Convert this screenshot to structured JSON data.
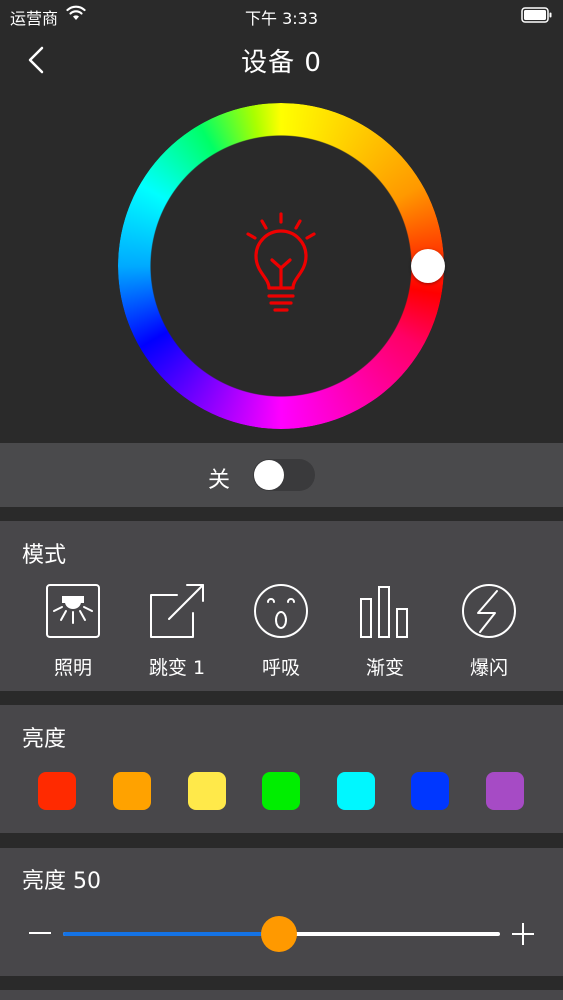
{
  "status_bar": {
    "carrier": "运营商",
    "time": "下午 3:33",
    "icons": [
      "wifi-icon",
      "battery-icon"
    ]
  },
  "nav": {
    "title": "设备 0",
    "back_icon": "chevron-left-icon"
  },
  "color_wheel": {
    "center_icon": "lightbulb-icon",
    "center_icon_color": "#ff0000",
    "selected_color": "#ff0000"
  },
  "power": {
    "label": "关",
    "state": "off"
  },
  "mode": {
    "title": "模式",
    "items": [
      {
        "label": "照明",
        "icon": "ceiling-light-icon"
      },
      {
        "label": "跳变 1",
        "icon": "jump-arrow-icon"
      },
      {
        "label": "呼吸",
        "icon": "breathing-face-icon"
      },
      {
        "label": "渐变",
        "icon": "gradient-bars-icon"
      },
      {
        "label": "爆闪",
        "icon": "flash-icon"
      }
    ]
  },
  "colors": {
    "title": "亮度",
    "swatches": [
      "#ff2a00",
      "#ffa200",
      "#ffe94a",
      "#00ee00",
      "#00f7ff",
      "#0037ff",
      "#a64bc5"
    ]
  },
  "brightness": {
    "title": "亮度 50",
    "value": 50,
    "min_icon": "minus-icon",
    "max_icon": "plus-icon",
    "fill_color": "#1473e6",
    "thumb_color": "#ff9900"
  }
}
